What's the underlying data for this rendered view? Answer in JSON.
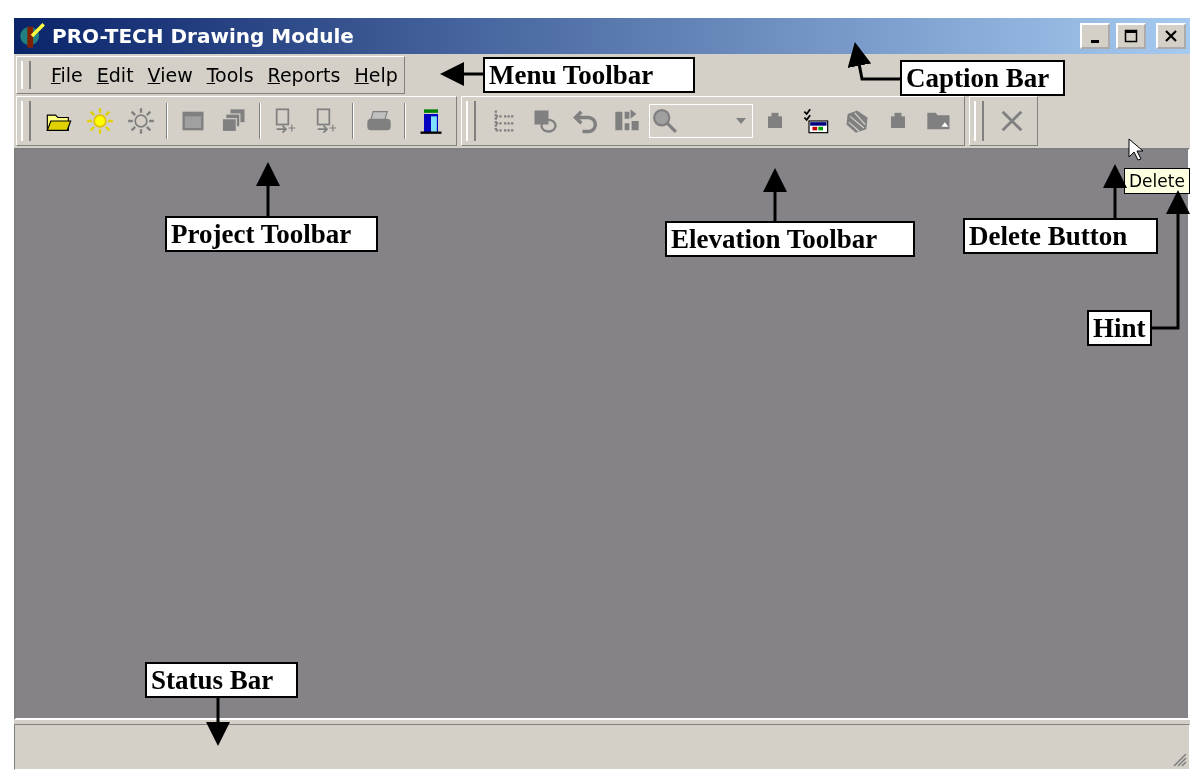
{
  "window": {
    "title": "PRO-TECH Drawing Module"
  },
  "menu": [
    {
      "label": "File"
    },
    {
      "label": "Edit"
    },
    {
      "label": "View"
    },
    {
      "label": "Tools"
    },
    {
      "label": "Reports"
    },
    {
      "label": "Help"
    }
  ],
  "project_toolbar": [
    {
      "kind": "open-folder",
      "disabled": false
    },
    {
      "kind": "sun",
      "disabled": false
    },
    {
      "kind": "sun",
      "disabled": true
    },
    {
      "kind": "separator"
    },
    {
      "kind": "window",
      "disabled": true
    },
    {
      "kind": "windows",
      "disabled": true
    },
    {
      "kind": "separator"
    },
    {
      "kind": "document-arrow",
      "disabled": true
    },
    {
      "kind": "document-arrow",
      "disabled": true
    },
    {
      "kind": "separator"
    },
    {
      "kind": "printer",
      "disabled": true
    },
    {
      "kind": "separator"
    },
    {
      "kind": "exit",
      "disabled": false
    }
  ],
  "elevation_toolbar": [
    {
      "kind": "tree",
      "disabled": true
    },
    {
      "kind": "shapes",
      "disabled": true
    },
    {
      "kind": "undo",
      "disabled": true
    },
    {
      "kind": "grid-arrow",
      "disabled": true
    },
    {
      "kind": "zoom-combo",
      "disabled": true
    },
    {
      "kind": "small-box",
      "disabled": true
    },
    {
      "kind": "checklist",
      "disabled": false
    },
    {
      "kind": "hatched-box",
      "disabled": true
    },
    {
      "kind": "small-box",
      "disabled": true
    },
    {
      "kind": "folder",
      "disabled": true
    }
  ],
  "delete_toolbar": [
    {
      "kind": "delete",
      "disabled": true
    }
  ],
  "tooltip": "Delete",
  "annotations": [
    {
      "label": "Menu Toolbar"
    },
    {
      "label": "Caption Bar"
    },
    {
      "label": "Project Toolbar"
    },
    {
      "label": "Elevation Toolbar"
    },
    {
      "label": "Delete Button"
    },
    {
      "label": "Hint"
    },
    {
      "label": "Status Bar"
    }
  ]
}
